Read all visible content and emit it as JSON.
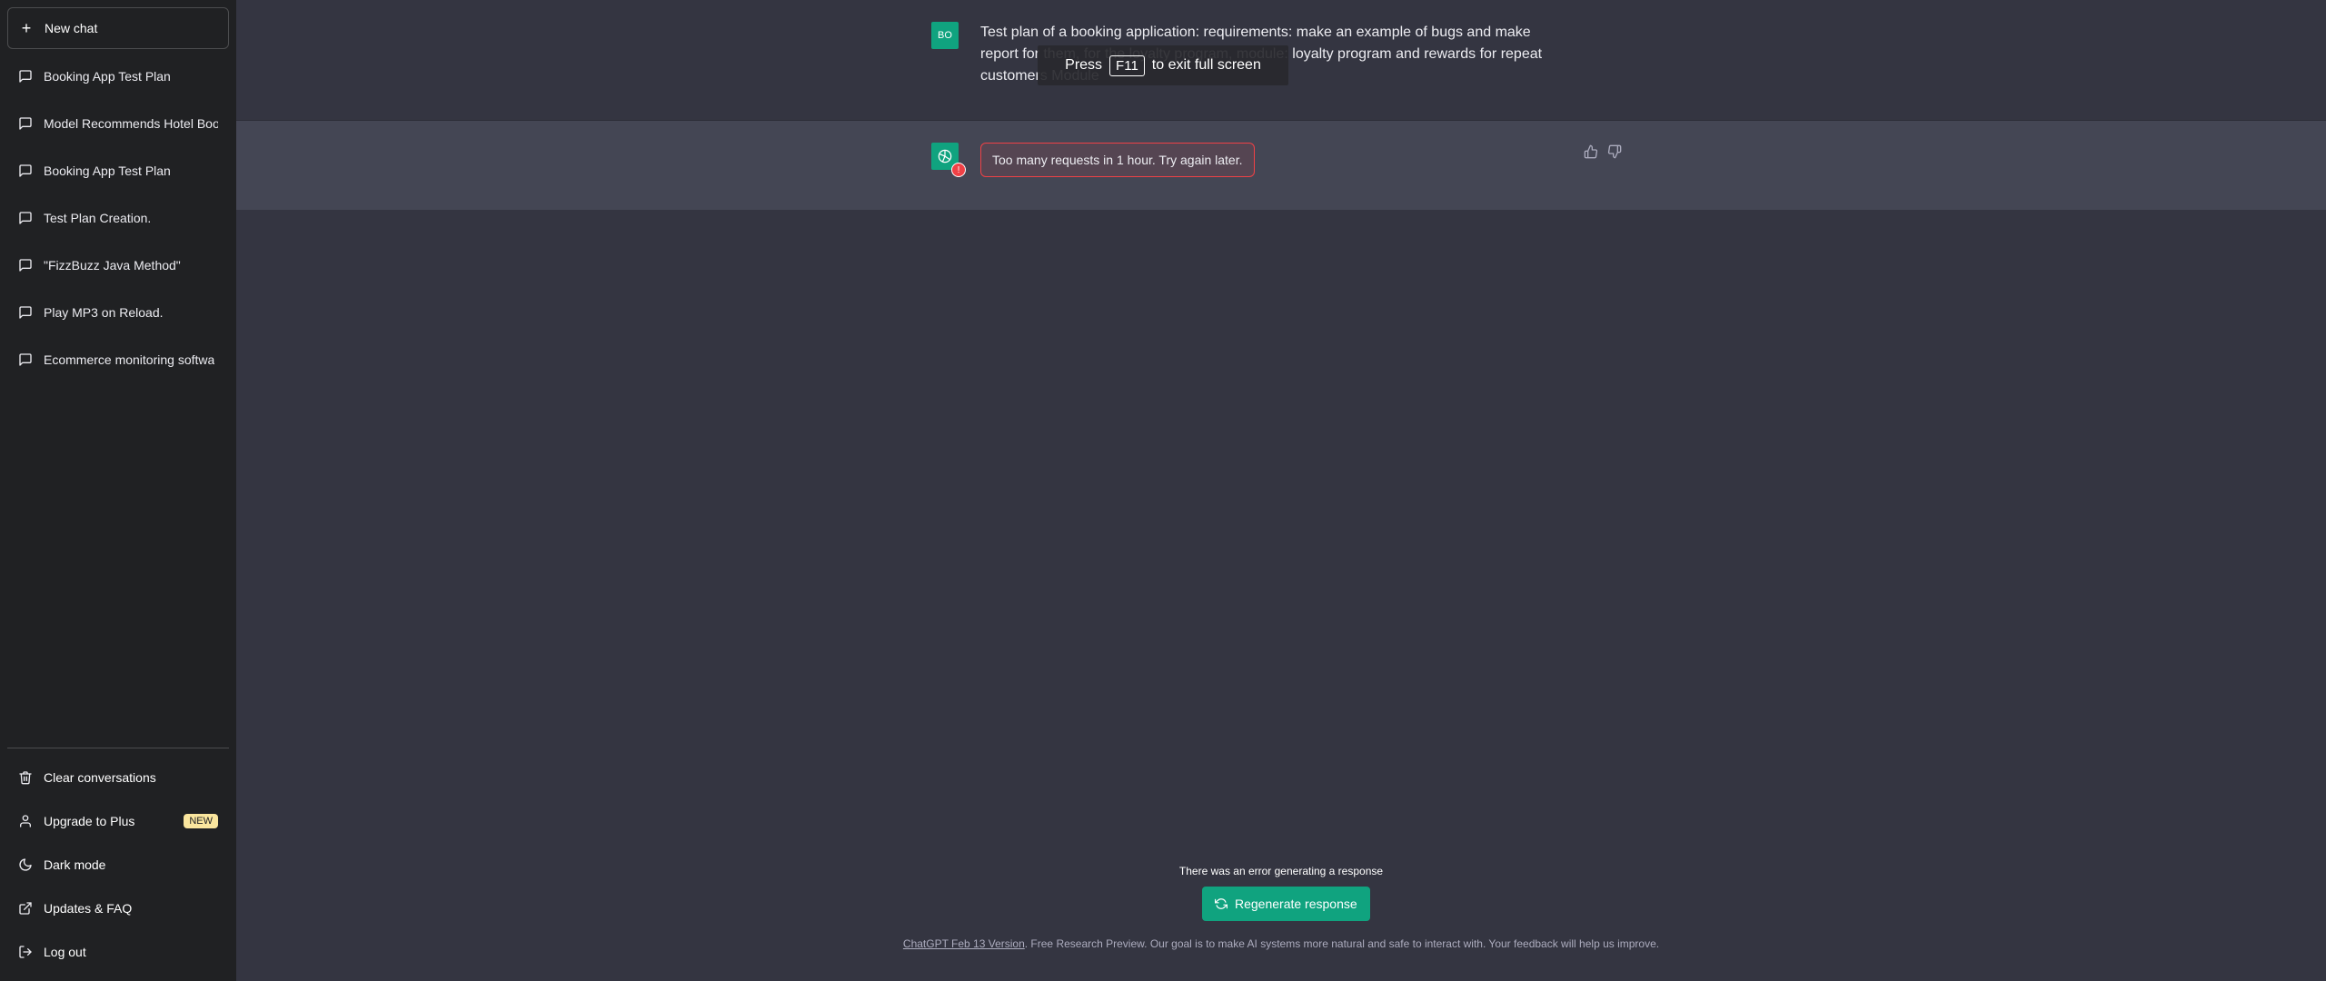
{
  "sidebar": {
    "new_chat": "New chat",
    "items": [
      {
        "label": "Booking App Test Plan",
        "icon": "chat-bubble-icon"
      },
      {
        "label": "Model Recommends Hotel Boo",
        "icon": "chat-bubble-icon"
      },
      {
        "label": "Booking App Test Plan",
        "icon": "chat-bubble-icon"
      },
      {
        "label": "Test Plan Creation.",
        "icon": "chat-bubble-icon"
      },
      {
        "label": "\"FizzBuzz Java Method\"",
        "icon": "chat-bubble-icon"
      },
      {
        "label": "Play MP3 on Reload.",
        "icon": "chat-bubble-icon"
      },
      {
        "label": "Ecommerce monitoring softwa",
        "icon": "chat-bubble-icon"
      }
    ],
    "bottom": {
      "clear": "Clear conversations",
      "upgrade": "Upgrade to Plus",
      "upgrade_badge": "NEW",
      "dark_mode": "Dark mode",
      "updates": "Updates & FAQ",
      "logout": "Log out"
    }
  },
  "conversation": {
    "user_initials": "BO",
    "user_message": "Test plan of a booking application: requirements: make an example of bugs and make report for them, for the loyalty program, module: loyalty program and rewards for repeat customers Module",
    "error_message": "Too many requests in 1 hour. Try again later.",
    "error_badge": "!"
  },
  "fullscreen_toast": {
    "before": "Press",
    "key": "F11",
    "after": "to exit full screen"
  },
  "bottom": {
    "error_note": "There was an error generating a response",
    "regenerate": "Regenerate response",
    "footer_link": "ChatGPT Feb 13 Version",
    "footer_text": ". Free Research Preview. Our goal is to make AI systems more natural and safe to interact with. Your feedback will help us improve."
  },
  "colors": {
    "sidebar_bg": "#202123",
    "main_bg": "#343541",
    "bot_bg": "#444654",
    "accent": "#10a37f",
    "error": "#ef4146",
    "badge": "#fae69e"
  }
}
